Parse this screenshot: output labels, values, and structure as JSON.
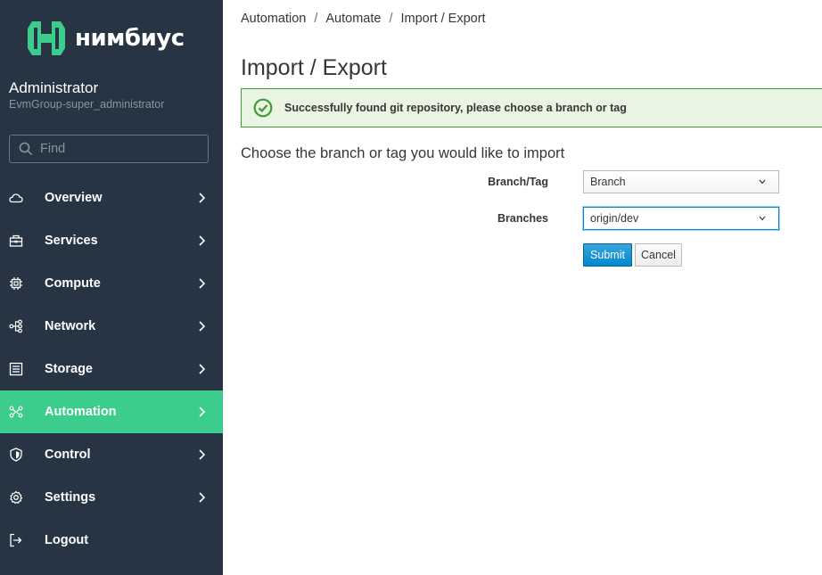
{
  "app": {
    "logo_text": "нимбиус",
    "brand_color": "#3ccd8d"
  },
  "user": {
    "name": "Administrator",
    "group": "EvmGroup-super_administrator"
  },
  "search": {
    "placeholder": "Find"
  },
  "nav": {
    "items": [
      {
        "label": "Overview",
        "icon": "cloud-icon",
        "active": false
      },
      {
        "label": "Services",
        "icon": "services-icon",
        "active": false
      },
      {
        "label": "Compute",
        "icon": "chip-icon",
        "active": false
      },
      {
        "label": "Network",
        "icon": "network-icon",
        "active": false
      },
      {
        "label": "Storage",
        "icon": "storage-icon",
        "active": false
      },
      {
        "label": "Automation",
        "icon": "automation-icon",
        "active": true
      },
      {
        "label": "Control",
        "icon": "shield-icon",
        "active": false
      },
      {
        "label": "Settings",
        "icon": "gear-icon",
        "active": false
      },
      {
        "label": "Logout",
        "icon": "logout-icon",
        "active": false
      }
    ]
  },
  "breadcrumb": {
    "items": [
      "Automation",
      "Automate",
      "Import / Export"
    ],
    "separator": "/"
  },
  "page": {
    "title": "Import / Export",
    "alert": "Successfully found git repository, please choose a branch or tag",
    "section_title": "Choose the branch or tag you would like to import"
  },
  "form": {
    "branch_tag_label": "Branch/Tag",
    "branch_tag_value": "Branch",
    "branches_label": "Branches",
    "branches_value": "origin/dev",
    "submit_label": "Submit",
    "cancel_label": "Cancel"
  }
}
